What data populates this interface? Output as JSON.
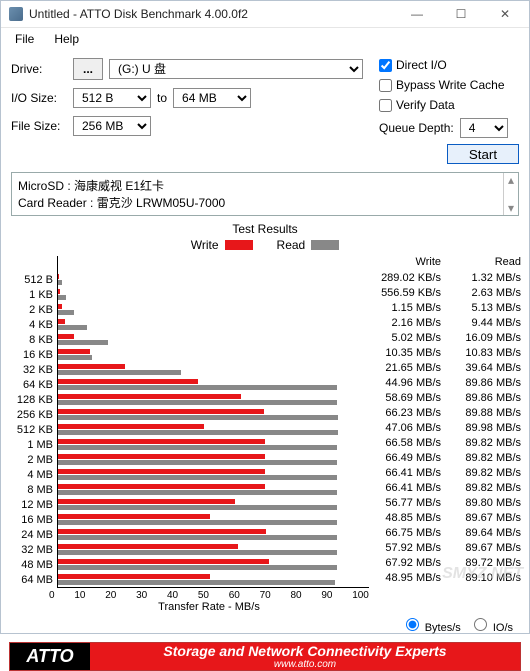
{
  "window": {
    "title": "Untitled - ATTO Disk Benchmark 4.00.0f2",
    "min": "—",
    "max": "☐",
    "close": "✕"
  },
  "menu": {
    "file": "File",
    "help": "Help"
  },
  "form": {
    "drive_label": "Drive:",
    "drive_btn": "...",
    "drive_value": "(G:) U 盘",
    "iosize_label": "I/O Size:",
    "iosize_from": "512 B",
    "iosize_to_lbl": "to",
    "iosize_to": "64 MB",
    "filesize_label": "File Size:",
    "filesize_value": "256 MB"
  },
  "options": {
    "direct_io": "Direct I/O",
    "bypass": "Bypass Write Cache",
    "verify": "Verify Data",
    "queue_label": "Queue Depth:",
    "queue_value": "4",
    "start": "Start"
  },
  "description": {
    "line1": "MicroSD : 海康威视 E1红卡",
    "line2": "Card Reader : 雷克沙 LRWM05U-7000"
  },
  "results": {
    "title": "Test Results",
    "legend_write": "Write",
    "legend_read": "Read",
    "col_write": "Write",
    "col_read": "Read",
    "axis_label": "Transfer Rate - MB/s",
    "unit_bytes": "Bytes/s",
    "unit_bits": "IO/s"
  },
  "chart_data": {
    "type": "bar",
    "orientation": "horizontal",
    "xlabel": "Transfer Rate - MB/s",
    "xlim": [
      0,
      100
    ],
    "xticks": [
      0,
      10,
      20,
      30,
      40,
      50,
      60,
      70,
      80,
      90,
      100
    ],
    "series": [
      {
        "name": "Write",
        "color": "#e7171a"
      },
      {
        "name": "Read",
        "color": "#888888"
      }
    ],
    "rows": [
      {
        "label": "512 B",
        "write_str": "289.02 KB/s",
        "read_str": "1.32 MB/s",
        "write_mb": 0.282,
        "read_mb": 1.32
      },
      {
        "label": "1 KB",
        "write_str": "556.59 KB/s",
        "read_str": "2.63 MB/s",
        "write_mb": 0.544,
        "read_mb": 2.63
      },
      {
        "label": "2 KB",
        "write_str": "1.15 MB/s",
        "read_str": "5.13 MB/s",
        "write_mb": 1.15,
        "read_mb": 5.13
      },
      {
        "label": "4 KB",
        "write_str": "2.16 MB/s",
        "read_str": "9.44 MB/s",
        "write_mb": 2.16,
        "read_mb": 9.44
      },
      {
        "label": "8 KB",
        "write_str": "5.02 MB/s",
        "read_str": "16.09 MB/s",
        "write_mb": 5.02,
        "read_mb": 16.09
      },
      {
        "label": "16 KB",
        "write_str": "10.35 MB/s",
        "read_str": "10.83 MB/s",
        "write_mb": 10.35,
        "read_mb": 10.83
      },
      {
        "label": "32 KB",
        "write_str": "21.65 MB/s",
        "read_str": "39.64 MB/s",
        "write_mb": 21.65,
        "read_mb": 39.64
      },
      {
        "label": "64 KB",
        "write_str": "44.96 MB/s",
        "read_str": "89.86 MB/s",
        "write_mb": 44.96,
        "read_mb": 89.86
      },
      {
        "label": "128 KB",
        "write_str": "58.69 MB/s",
        "read_str": "89.86 MB/s",
        "write_mb": 58.69,
        "read_mb": 89.86
      },
      {
        "label": "256 KB",
        "write_str": "66.23 MB/s",
        "read_str": "89.88 MB/s",
        "write_mb": 66.23,
        "read_mb": 89.88
      },
      {
        "label": "512 KB",
        "write_str": "47.06 MB/s",
        "read_str": "89.98 MB/s",
        "write_mb": 47.06,
        "read_mb": 89.98
      },
      {
        "label": "1 MB",
        "write_str": "66.58 MB/s",
        "read_str": "89.82 MB/s",
        "write_mb": 66.58,
        "read_mb": 89.82
      },
      {
        "label": "2 MB",
        "write_str": "66.49 MB/s",
        "read_str": "89.82 MB/s",
        "write_mb": 66.49,
        "read_mb": 89.82
      },
      {
        "label": "4 MB",
        "write_str": "66.41 MB/s",
        "read_str": "89.82 MB/s",
        "write_mb": 66.41,
        "read_mb": 89.82
      },
      {
        "label": "8 MB",
        "write_str": "66.41 MB/s",
        "read_str": "89.82 MB/s",
        "write_mb": 66.41,
        "read_mb": 89.82
      },
      {
        "label": "12 MB",
        "write_str": "56.77 MB/s",
        "read_str": "89.80 MB/s",
        "write_mb": 56.77,
        "read_mb": 89.8
      },
      {
        "label": "16 MB",
        "write_str": "48.85 MB/s",
        "read_str": "89.67 MB/s",
        "write_mb": 48.85,
        "read_mb": 89.67
      },
      {
        "label": "24 MB",
        "write_str": "66.75 MB/s",
        "read_str": "89.64 MB/s",
        "write_mb": 66.75,
        "read_mb": 89.64
      },
      {
        "label": "32 MB",
        "write_str": "57.92 MB/s",
        "read_str": "89.67 MB/s",
        "write_mb": 57.92,
        "read_mb": 89.67
      },
      {
        "label": "48 MB",
        "write_str": "67.92 MB/s",
        "read_str": "89.72 MB/s",
        "write_mb": 67.92,
        "read_mb": 89.72
      },
      {
        "label": "64 MB",
        "write_str": "48.95 MB/s",
        "read_str": "89.10 MB/s",
        "write_mb": 48.95,
        "read_mb": 89.1
      }
    ]
  },
  "footer": {
    "logo": "ATTO",
    "main": "Storage and Network Connectivity Experts",
    "sub": "www.atto.com"
  },
  "watermark": "SMYZ.NET"
}
